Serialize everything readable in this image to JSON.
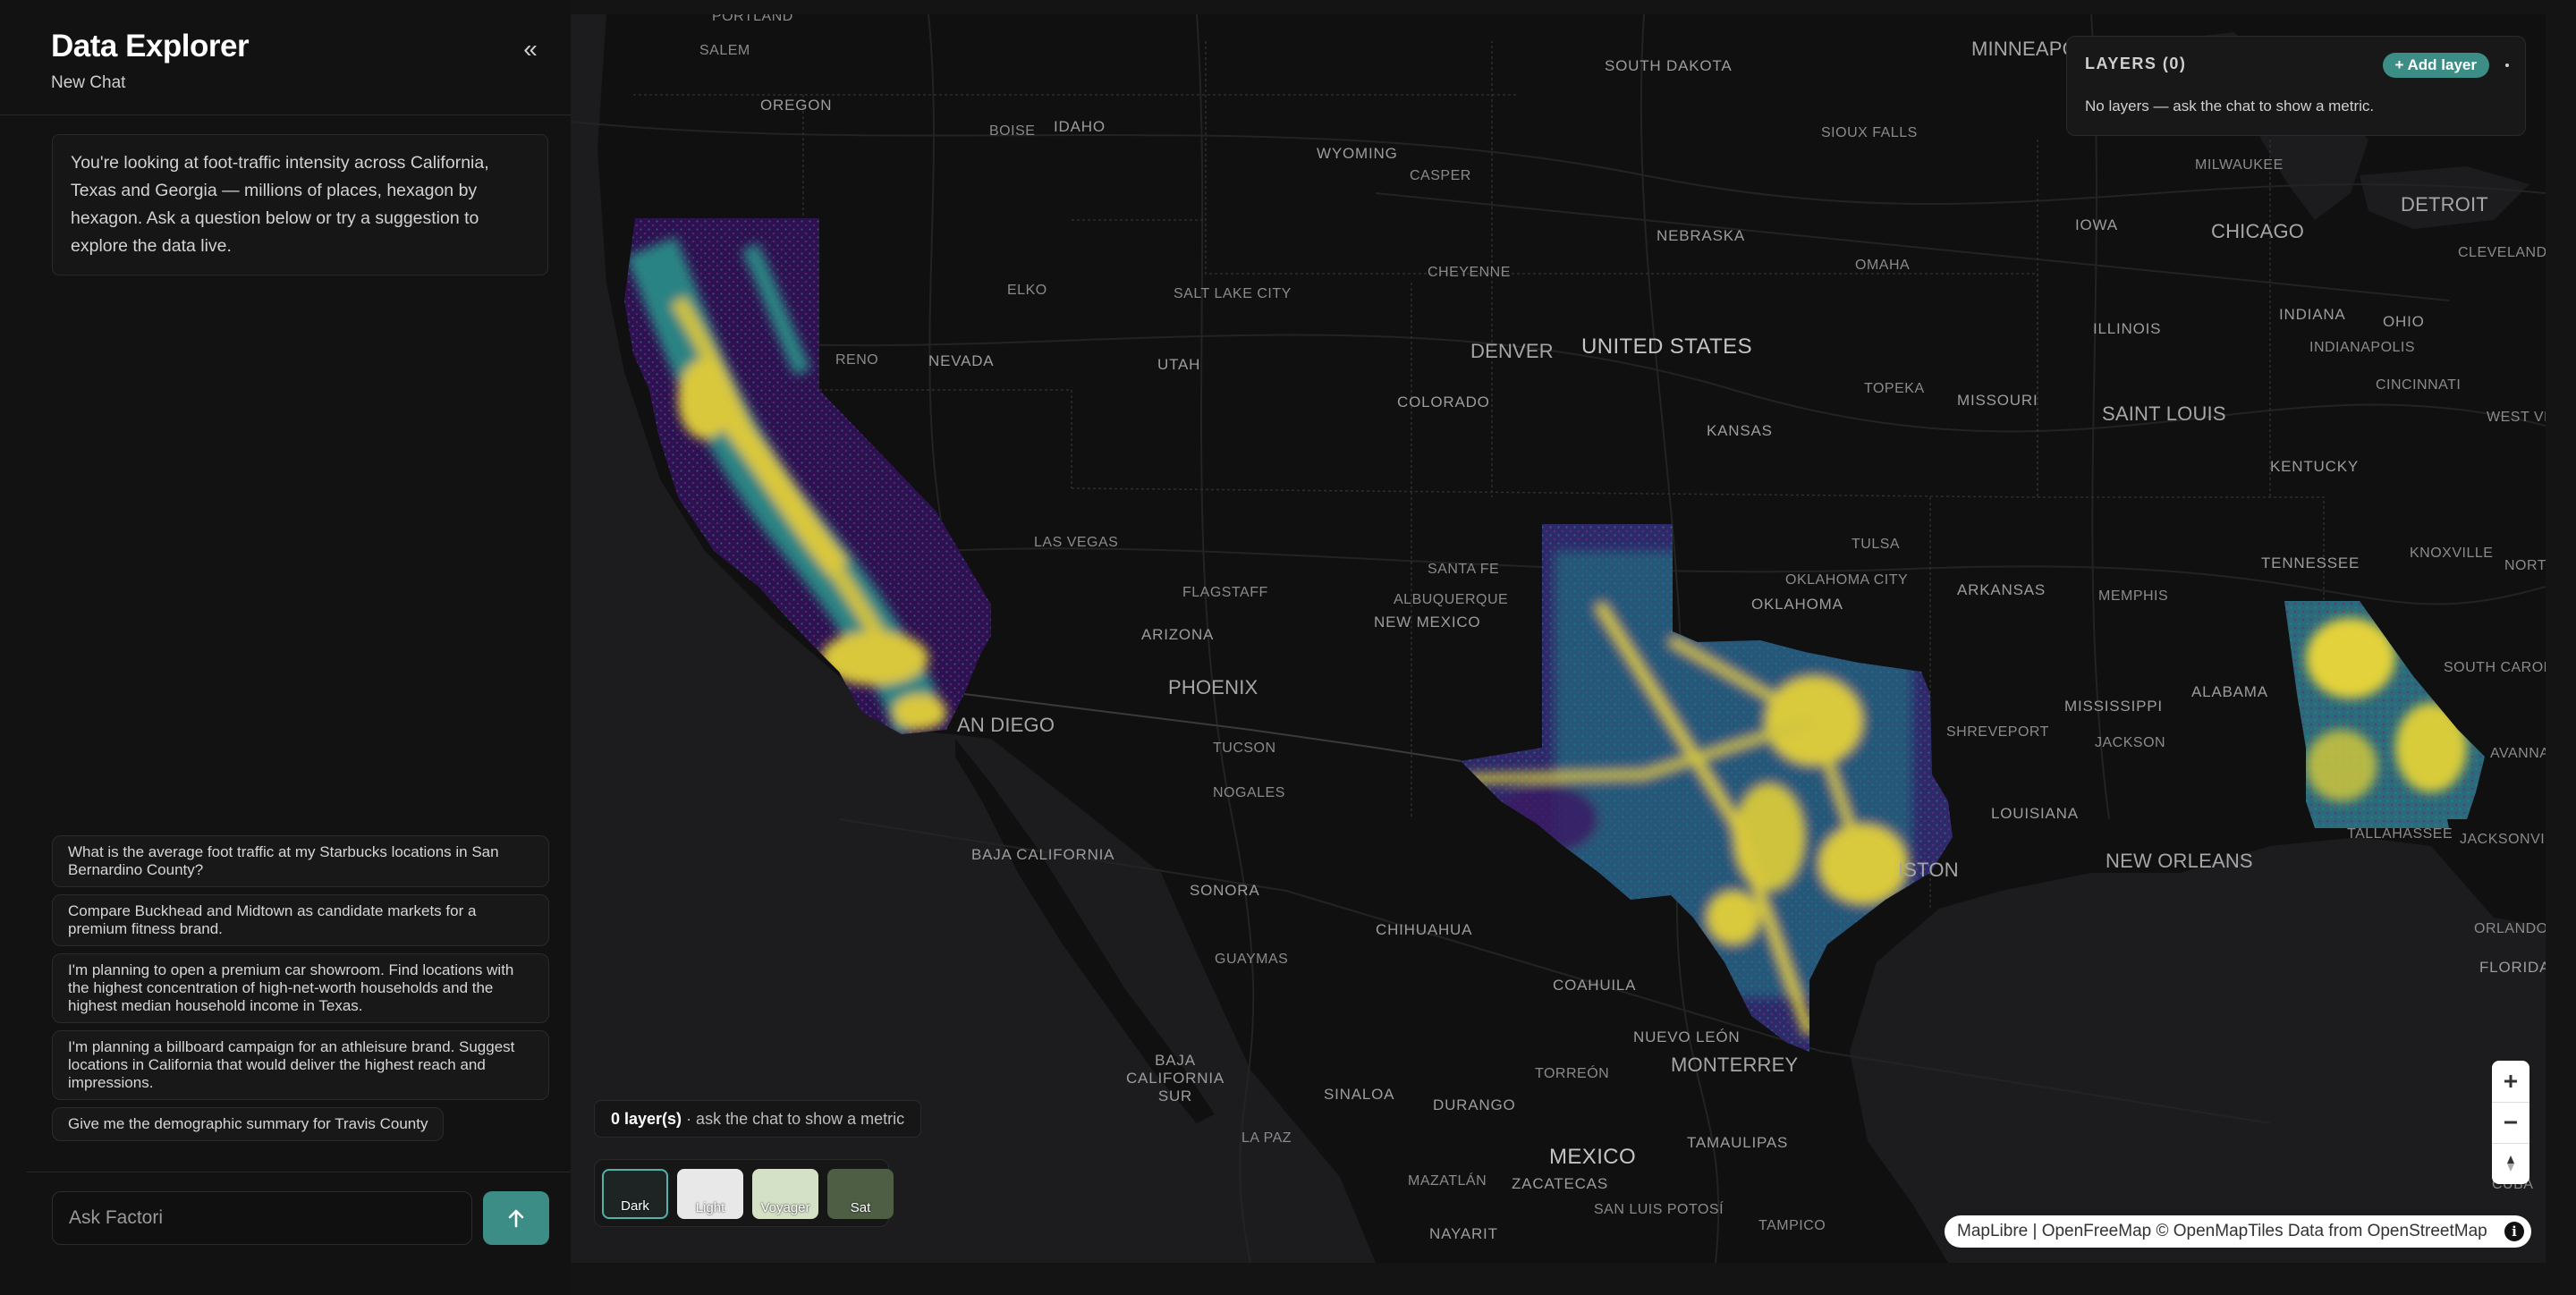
{
  "sidebar": {
    "title": "Data Explorer",
    "subtitle": "New Chat",
    "collapse_symbol": "«",
    "intro": "You're looking at foot-traffic intensity across California, Texas and Georgia — millions of places, hexagon by hexagon. Ask a question below or try a suggestion to explore the data live.",
    "suggestions": [
      "What is the average foot traffic at my Starbucks locations in San Bernardino County?",
      "Compare Buckhead and Midtown as candidate markets for a premium fitness brand.",
      "I'm planning to open a premium car showroom. Find locations with the highest concentration of high-net-worth households and the highest median household income in Texas.",
      "I'm planning a billboard campaign for an athleisure brand. Suggest locations in California that would deliver the highest reach and impressions.",
      "Give me the demographic summary for Travis County"
    ],
    "input_placeholder": "Ask Factori",
    "send_icon": "arrow-up-icon"
  },
  "layers_panel": {
    "title": "LAYERS (0)",
    "add_label": "+ Add layer",
    "empty_text": "No layers — ask the chat to show a metric."
  },
  "status": {
    "count": "0 layer(s)",
    "hint": " · ask the chat to show a metric"
  },
  "basemaps": {
    "dark": "Dark",
    "light": "Light",
    "voyager": "Voyager",
    "sat": "Sat",
    "selected": "Dark"
  },
  "attribution": {
    "text": "MapLibre | OpenFreeMap © OpenMapTiles Data from OpenStreetMap",
    "info": "i"
  },
  "colors": {
    "accent": "#3c8d86",
    "heat_low": "#3b1563",
    "heat_mid": "#2a8a86",
    "heat_high": "#e3d23a"
  },
  "map_labels": {
    "portland": "PORTLAND",
    "salem": "SALEM",
    "oregon": "OREGON",
    "boise": "BOISE",
    "idaho": "IDAHO",
    "wyoming": "WYOMING",
    "casper": "CASPER",
    "south_dakota": "SOUTH DAKOTA",
    "minneapolis": "MINNEAPOLIS",
    "sioux_falls": "SIOUX FALLS",
    "milwaukee": "MILWAUKEE",
    "detroit": "DETROIT",
    "chicago": "CHICAGO",
    "iowa": "IOWA",
    "nebraska": "NEBRASKA",
    "omaha": "OMAHA",
    "cleveland": "CLEVELAND",
    "elko": "ELKO",
    "salt_lake_city": "SALT LAKE CITY",
    "cheyenne": "CHEYENNE",
    "denver": "DENVER",
    "united_states": "UNITED STATES",
    "illinois": "ILLINOIS",
    "indiana": "INDIANA",
    "ohio": "OHIO",
    "indianapolis": "INDIANAPOLIS",
    "reno": "RENO",
    "nevada": "NEVADA",
    "utah": "UTAH",
    "colorado": "COLORADO",
    "topeka": "TOPEKA",
    "missouri": "MISSOURI",
    "saint_louis": "SAINT LOUIS",
    "cincinnati": "CINCINNATI",
    "west_virginia": "WEST VIRGINIA",
    "kansas": "KANSAS",
    "kentucky": "KENTUCKY",
    "las_vegas": "LAS VEGAS",
    "tulsa": "TULSA",
    "tennessee": "TENNESSEE",
    "knoxville": "KNOXVILLE",
    "north": "NORTI",
    "santa_fe": "SANTA FE",
    "oklahoma_city": "OKLAHOMA CITY",
    "oklahoma": "OKLAHOMA",
    "arkansas": "ARKANSAS",
    "memphis": "MEMPHIS",
    "flagstaff": "FLAGSTAFF",
    "albuquerque": "ALBUQUERQUE",
    "new_mexico": "NEW MEXICO",
    "arizona": "ARIZONA",
    "phoenix": "PHOENIX",
    "south_carolina": "SOUTH CAROLI",
    "mississippi": "MISSISSIPPI",
    "alabama": "ALABAMA",
    "shreveport": "SHREVEPORT",
    "jackson": "JACKSON",
    "savannah": "AVANNA",
    "tucson": "TUCSON",
    "nogales": "NOGALES",
    "louisiana": "LOUISIANA",
    "tallahassee": "TALLAHASSEE",
    "jacksonville": "JACKSONVILLE",
    "baja_california": "BAJA CALIFORNIA",
    "new_orleans": "NEW ORLEANS",
    "houston": "ISTON",
    "sonora": "SONORA",
    "chihuahua": "CHIHUAHUA",
    "orlando": "ORLANDO",
    "guaymas": "GUAYMAS",
    "florida": "FLORIDA",
    "coahuila": "COAHUILA",
    "nuevo_leon": "NUEVO LEÓN",
    "monterrey": "MONTERREY",
    "baja_california_sur": "BAJA CALIFORNIA SUR",
    "torreon": "TORREÓN",
    "sinaloa": "SINALOA",
    "durango": "DURANGO",
    "tamaulipas": "TAMAULIPAS",
    "la_paz": "LA PAZ",
    "mexico": "MEXICO",
    "mazatlan": "MAZATLÁN",
    "zacatecas": "ZACATECAS",
    "san_luis_potosi": "SAN LUIS POTOSÍ",
    "tampico": "TAMPICO",
    "nayarit": "NAYARIT",
    "cuba": "CUBA",
    "san_diego": "AN DIEGO"
  }
}
